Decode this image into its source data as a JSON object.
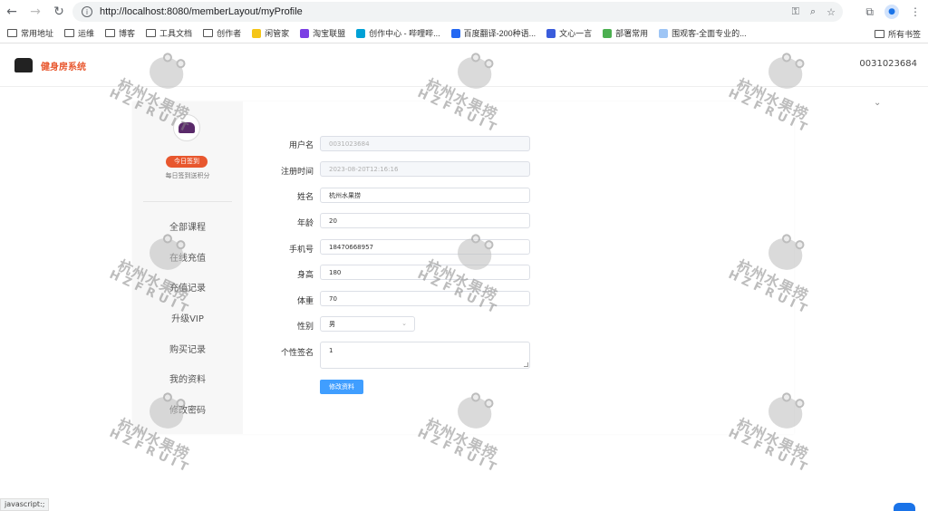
{
  "browser": {
    "url": "http://localhost:8080/memberLayout/myProfile",
    "bookmarks": [
      {
        "label": "常用地址",
        "type": "folder"
      },
      {
        "label": "运维",
        "type": "folder"
      },
      {
        "label": "博客",
        "type": "folder"
      },
      {
        "label": "工具文档",
        "type": "folder"
      },
      {
        "label": "创作者",
        "type": "folder"
      },
      {
        "label": "闲管家",
        "type": "site",
        "color": "#f5c518"
      },
      {
        "label": "淘宝联盟",
        "type": "site",
        "color": "#7b3fe4"
      },
      {
        "label": "创作中心 - 哔哩哔...",
        "type": "site",
        "color": "#00a1d6"
      },
      {
        "label": "百度翻译-200种语...",
        "type": "site",
        "color": "#2468f2"
      },
      {
        "label": "文心一言",
        "type": "site",
        "color": "#3a5cdb"
      },
      {
        "label": "部署常用",
        "type": "site",
        "color": "#4caf50"
      },
      {
        "label": "围观客-全面专业的...",
        "type": "site",
        "color": "#9ec5f5"
      }
    ],
    "bookmarks_right": "所有书签",
    "status_text": "javascript:;"
  },
  "header": {
    "brand": "健身房系统",
    "user_id": "0031023684"
  },
  "sidebar": {
    "checkin_label": "今日签到",
    "checkin_hint": "每日签到送积分",
    "items": [
      {
        "label": "全部课程"
      },
      {
        "label": "在线充值"
      },
      {
        "label": "充值记录"
      },
      {
        "label": "升级VIP"
      },
      {
        "label": "购买记录"
      },
      {
        "label": "我的资料"
      },
      {
        "label": "修改密码"
      }
    ]
  },
  "form": {
    "username_label": "用户名",
    "username_value": "0031023684",
    "regtime_label": "注册时间",
    "regtime_value": "2023-08-20T12:16:16",
    "name_label": "姓名",
    "name_value": "杭州水果捞",
    "age_label": "年龄",
    "age_value": "20",
    "phone_label": "手机号",
    "phone_value": "18470668957",
    "height_label": "身高",
    "height_value": "180",
    "weight_label": "体重",
    "weight_value": "70",
    "gender_label": "性别",
    "gender_value": "男",
    "signature_label": "个性签名",
    "signature_value": "1",
    "submit_label": "修改资料"
  },
  "watermark": {
    "line1": "杭州水果捞",
    "line2": "HZFRUIT"
  },
  "colors": {
    "accent": "#e8572e",
    "primary_button": "#409eff"
  }
}
